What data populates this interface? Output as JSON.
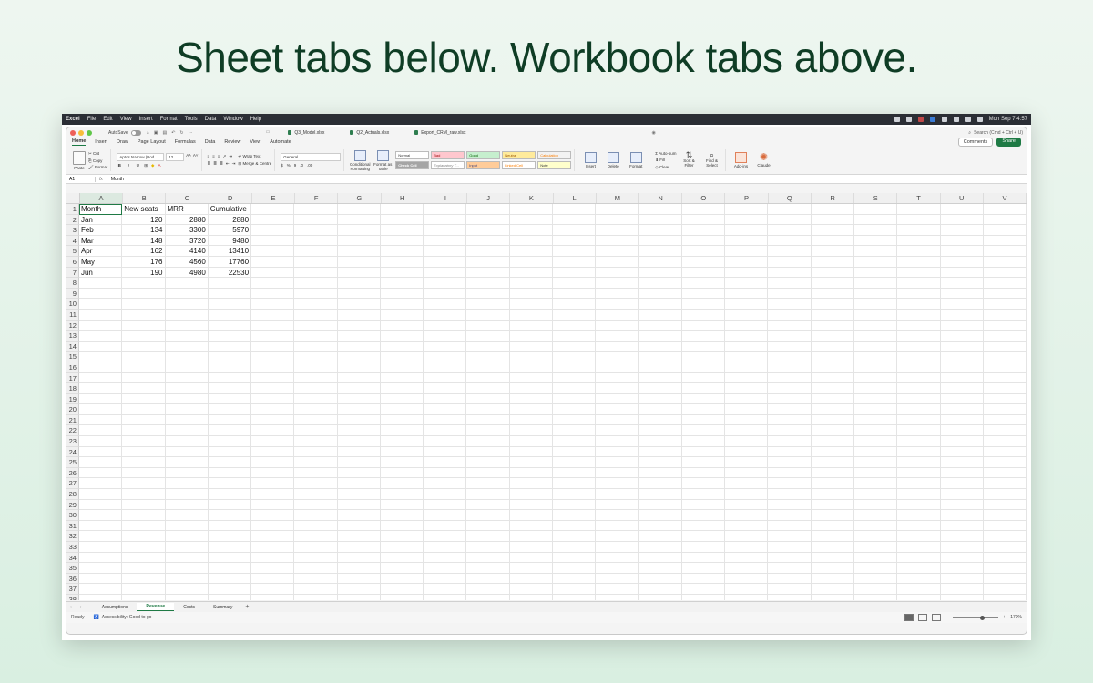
{
  "headline": "Sheet tabs below. Workbook tabs above.",
  "menubar": {
    "app": "Excel",
    "items": [
      "File",
      "Edit",
      "View",
      "Insert",
      "Format",
      "Tools",
      "Data",
      "Window",
      "Help"
    ],
    "clock": "Mon Sep 7  4:57"
  },
  "titlebar": {
    "autosave_label": "AutoSave",
    "workbook_tabs": [
      "Q3_Model.xlsx",
      "Q2_Actuals.xlsx",
      "Export_CRM_raw.xlsx"
    ],
    "search_placeholder": "Search (Cmd + Ctrl + U)"
  },
  "ribbon_tabs": [
    "Home",
    "Insert",
    "Draw",
    "Page Layout",
    "Formulas",
    "Data",
    "Review",
    "View",
    "Automate"
  ],
  "ribbon_buttons": {
    "comments": "Comments",
    "share": "Share"
  },
  "ribbon": {
    "paste": "Paste",
    "cut": "Cut",
    "copy": "Copy",
    "format": "Format",
    "font_name": "Aptos Narrow (Bod...",
    "font_size": "12",
    "wrap_text": "Wrap Text",
    "merge_centre": "Merge & Centre",
    "number_format": "General",
    "conditional_formatting": "Conditional Formatting",
    "format_as_table": "Format as Table",
    "styles": [
      "Normal",
      "Bad",
      "Good",
      "Neutral",
      "Calculation",
      "Check Cell",
      "Explanatory T...",
      "Input",
      "Linked Cell",
      "Note"
    ],
    "insert": "Insert",
    "delete": "Delete",
    "format_cells": "Format",
    "autosum": "Auto-sum",
    "fill": "Fill",
    "clear": "Clear",
    "sort_filter": "Sort & Filter",
    "find_select": "Find & Select",
    "addins": "Add-ins",
    "claude": "Claude"
  },
  "formula_bar": {
    "name_box": "A1",
    "fx": "fx",
    "content": "Month"
  },
  "columns": [
    "A",
    "B",
    "C",
    "D",
    "E",
    "F",
    "G",
    "H",
    "I",
    "J",
    "K",
    "L",
    "M",
    "N",
    "O",
    "P",
    "Q",
    "R",
    "S",
    "T",
    "U",
    "V"
  ],
  "row_count": 38,
  "table": {
    "headers": [
      "Month",
      "New seats",
      "MRR",
      "Cumulative"
    ],
    "rows": [
      [
        "Jan",
        "120",
        "2880",
        "2880"
      ],
      [
        "Feb",
        "134",
        "3300",
        "5970"
      ],
      [
        "Mar",
        "148",
        "3720",
        "9480"
      ],
      [
        "Apr",
        "162",
        "4140",
        "13410"
      ],
      [
        "May",
        "176",
        "4560",
        "17760"
      ],
      [
        "Jun",
        "190",
        "4980",
        "22530"
      ]
    ]
  },
  "sheet_tabs": [
    "Assumptions",
    "Revenue",
    "Costs",
    "Summary"
  ],
  "active_sheet": "Revenue",
  "status": {
    "ready": "Ready",
    "accessibility": "Accessibility: Good to go",
    "zoom": "170%"
  },
  "colors": {
    "accent": "#1f7a45",
    "headline": "#0f3d25"
  }
}
